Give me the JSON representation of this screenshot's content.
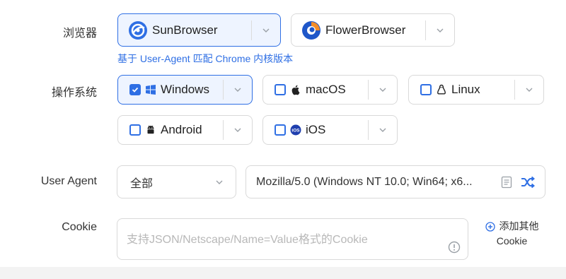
{
  "browser": {
    "label": "浏览器",
    "options": [
      {
        "name": "SunBrowser",
        "selected": true
      },
      {
        "name": "FlowerBrowser",
        "selected": false
      }
    ],
    "hint": "基于 User-Agent 匹配 Chrome 内核版本"
  },
  "os": {
    "label": "操作系统",
    "options": [
      {
        "name": "Windows",
        "icon": "windows-icon",
        "checked": true
      },
      {
        "name": "macOS",
        "icon": "apple-icon",
        "checked": false
      },
      {
        "name": "Linux",
        "icon": "linux-icon",
        "checked": false
      },
      {
        "name": "Android",
        "icon": "android-icon",
        "checked": false
      },
      {
        "name": "iOS",
        "icon": "ios-icon",
        "checked": false
      }
    ]
  },
  "user_agent": {
    "label": "User Agent",
    "scope_value": "全部",
    "value": "Mozilla/5.0 (Windows NT 10.0; Win64; x6..."
  },
  "cookie": {
    "label": "Cookie",
    "placeholder": "支持JSON/Netscape/Name=Value格式的Cookie",
    "add_other_line1": "添加其他",
    "add_other_line2": "Cookie"
  },
  "colors": {
    "accent": "#2f6fe4",
    "selected_bg": "#eef4ff",
    "border": "#d9d9d9"
  }
}
